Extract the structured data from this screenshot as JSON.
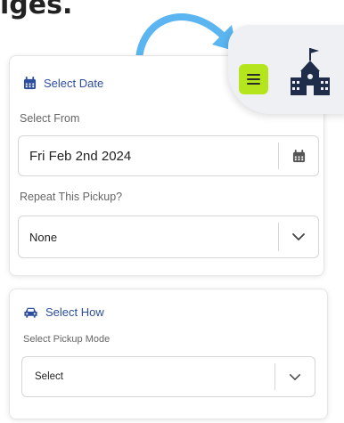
{
  "caption": "iges.",
  "date_section": {
    "title": "Select Date",
    "from_label": "Select From",
    "from_value": "Fri Feb 2nd 2024",
    "repeat_label": "Repeat This Pickup?",
    "repeat_value": "None"
  },
  "how_section": {
    "title": "Select How",
    "mode_label": "Select Pickup Mode",
    "mode_value": "Select"
  },
  "colors": {
    "accent": "#2d4e9c",
    "menu_button": "#b5e61d",
    "arrow": "#5bb5f0"
  },
  "icons": [
    "calendar-icon",
    "car-icon",
    "chevron-down-icon",
    "menu-icon",
    "school-icon",
    "curved-arrow-icon"
  ]
}
